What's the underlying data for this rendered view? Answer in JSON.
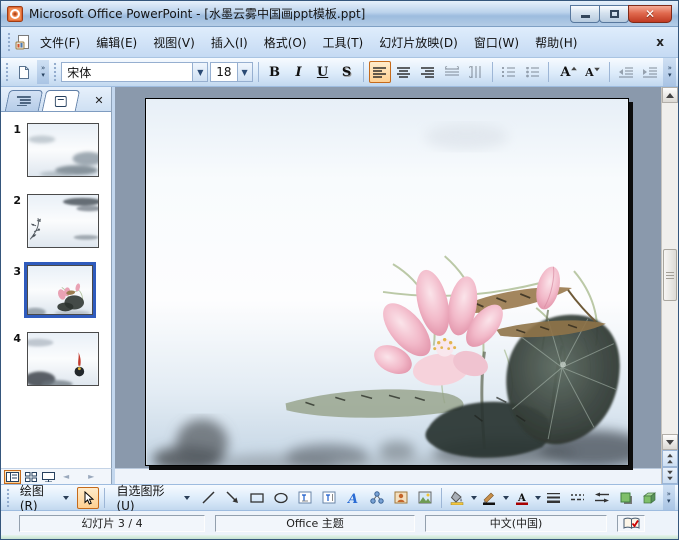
{
  "window": {
    "title": "Microsoft Office PowerPoint - [水墨云雾中国画ppt模板.ppt]"
  },
  "menubar": {
    "items": [
      {
        "label": "文件(F)"
      },
      {
        "label": "编辑(E)"
      },
      {
        "label": "视图(V)"
      },
      {
        "label": "插入(I)"
      },
      {
        "label": "格式(O)"
      },
      {
        "label": "工具(T)"
      },
      {
        "label": "幻灯片放映(D)"
      },
      {
        "label": "窗口(W)"
      },
      {
        "label": "帮助(H)"
      }
    ]
  },
  "formatting_toolbar": {
    "font_name": "宋体",
    "font_size": "18",
    "bold_label": "B",
    "italic_label": "I",
    "underline_label": "U",
    "shadow_label": "S",
    "grow_font_label": "A",
    "shrink_font_label": "A"
  },
  "slides_panel": {
    "slides": [
      {
        "number": "1"
      },
      {
        "number": "2"
      },
      {
        "number": "3"
      },
      {
        "number": "4"
      }
    ],
    "selected_slide_number": "3"
  },
  "drawing_toolbar": {
    "draw_label": "绘图(R)",
    "autoshapes_label": "自选图形(U)"
  },
  "status_bar": {
    "slide_indicator": "幻灯片 3 / 4",
    "theme": "Office 主题",
    "language": "中文(中国)"
  },
  "colors": {
    "selection_blue": "#2f5bbd",
    "active_highlight_orange": "#ffd091",
    "canvas_gray": "#8a99ac",
    "close_button_red": "#c03a22",
    "titlebar_blue": "#b3cce6"
  }
}
